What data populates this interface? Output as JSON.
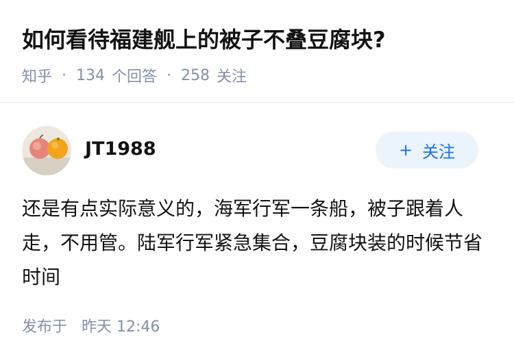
{
  "question": {
    "title": "如何看待福建舰上的被子不叠豆腐块?",
    "source": "知乎",
    "separator": "·",
    "answer_count": "134",
    "answer_label": "个回答",
    "follower_count": "258",
    "follower_label": "关注"
  },
  "answer": {
    "author_name": "JT1988",
    "follow_button_plus": "+",
    "follow_button_label": "关注",
    "content": "还是有点实际意义的，海军行军一条船，被子跟着人走，不用管。陆军行军紧急集合，豆腐块装的时候节省时间",
    "published_label": "发布于",
    "published_time": "昨天 12:46"
  },
  "icons": {
    "avatar_image": "avatar-apple-and-orange"
  },
  "colors": {
    "primary_text": "#121212",
    "secondary_text": "#8590a6",
    "accent_blue": "#1772f6",
    "follow_button_bg": "#ebf3fb",
    "divider": "#ebebeb"
  }
}
